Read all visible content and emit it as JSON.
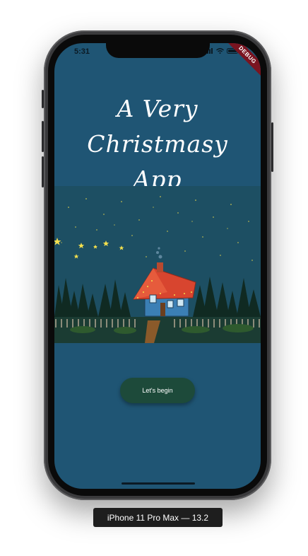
{
  "status_bar": {
    "time": "5:31"
  },
  "debug_banner": "DEBUG",
  "title": {
    "line1": "A Very Christmasy",
    "line2": "App"
  },
  "illustration": {
    "icon": "christmas-house-night-scene"
  },
  "actions": {
    "begin_label": "Let's begin"
  },
  "device_label": "iPhone 11 Pro Max — 13.2",
  "colors": {
    "screen_bg": "#1f5574",
    "button_bg": "#1d4a3a",
    "ribbon": "#7a1420",
    "roof": "#d8452f",
    "house": "#3b7fb5"
  }
}
